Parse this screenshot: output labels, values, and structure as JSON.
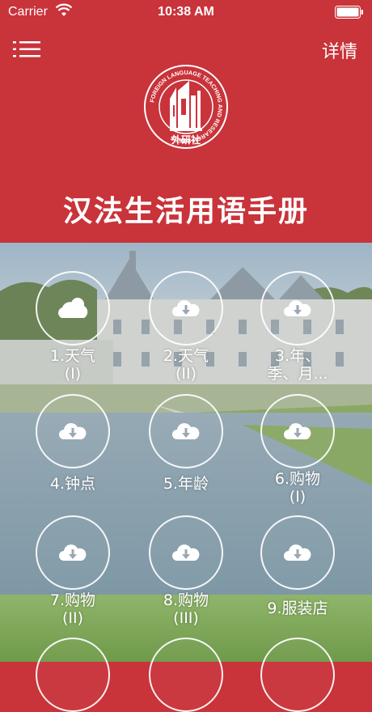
{
  "status_bar": {
    "carrier": "Carrier",
    "time": "10:38 AM"
  },
  "nav": {
    "menu_icon": "list-icon",
    "detail_label": "详情"
  },
  "logo": {
    "ring_text": "FOREIGN LANGUAGE TEACHING AND RESEARCH PRESS",
    "chinese": "外研社"
  },
  "title": "汉法生活用语手册",
  "lessons": [
    {
      "label": "1.天气\n(I)",
      "icon": "cloud-icon"
    },
    {
      "label": "2.天气\n(II)",
      "icon": "cloud-download-icon"
    },
    {
      "label": "3.年、\n季、月...",
      "icon": "cloud-download-icon"
    },
    {
      "label": "4.钟点",
      "icon": "cloud-download-icon"
    },
    {
      "label": "5.年龄",
      "icon": "cloud-download-icon"
    },
    {
      "label": "6.购物\n(I)",
      "icon": "cloud-download-icon"
    },
    {
      "label": "7.购物\n(II)",
      "icon": "cloud-download-icon"
    },
    {
      "label": "8.购物\n(III)",
      "icon": "cloud-download-icon"
    },
    {
      "label": "9.服装店",
      "icon": "cloud-download-icon"
    },
    {
      "label": "",
      "icon": "cloud-download-icon"
    },
    {
      "label": "",
      "icon": "cloud-download-icon"
    },
    {
      "label": "",
      "icon": "cloud-download-icon"
    }
  ],
  "colors": {
    "header_red": "#c9333a",
    "white": "#ffffff"
  }
}
